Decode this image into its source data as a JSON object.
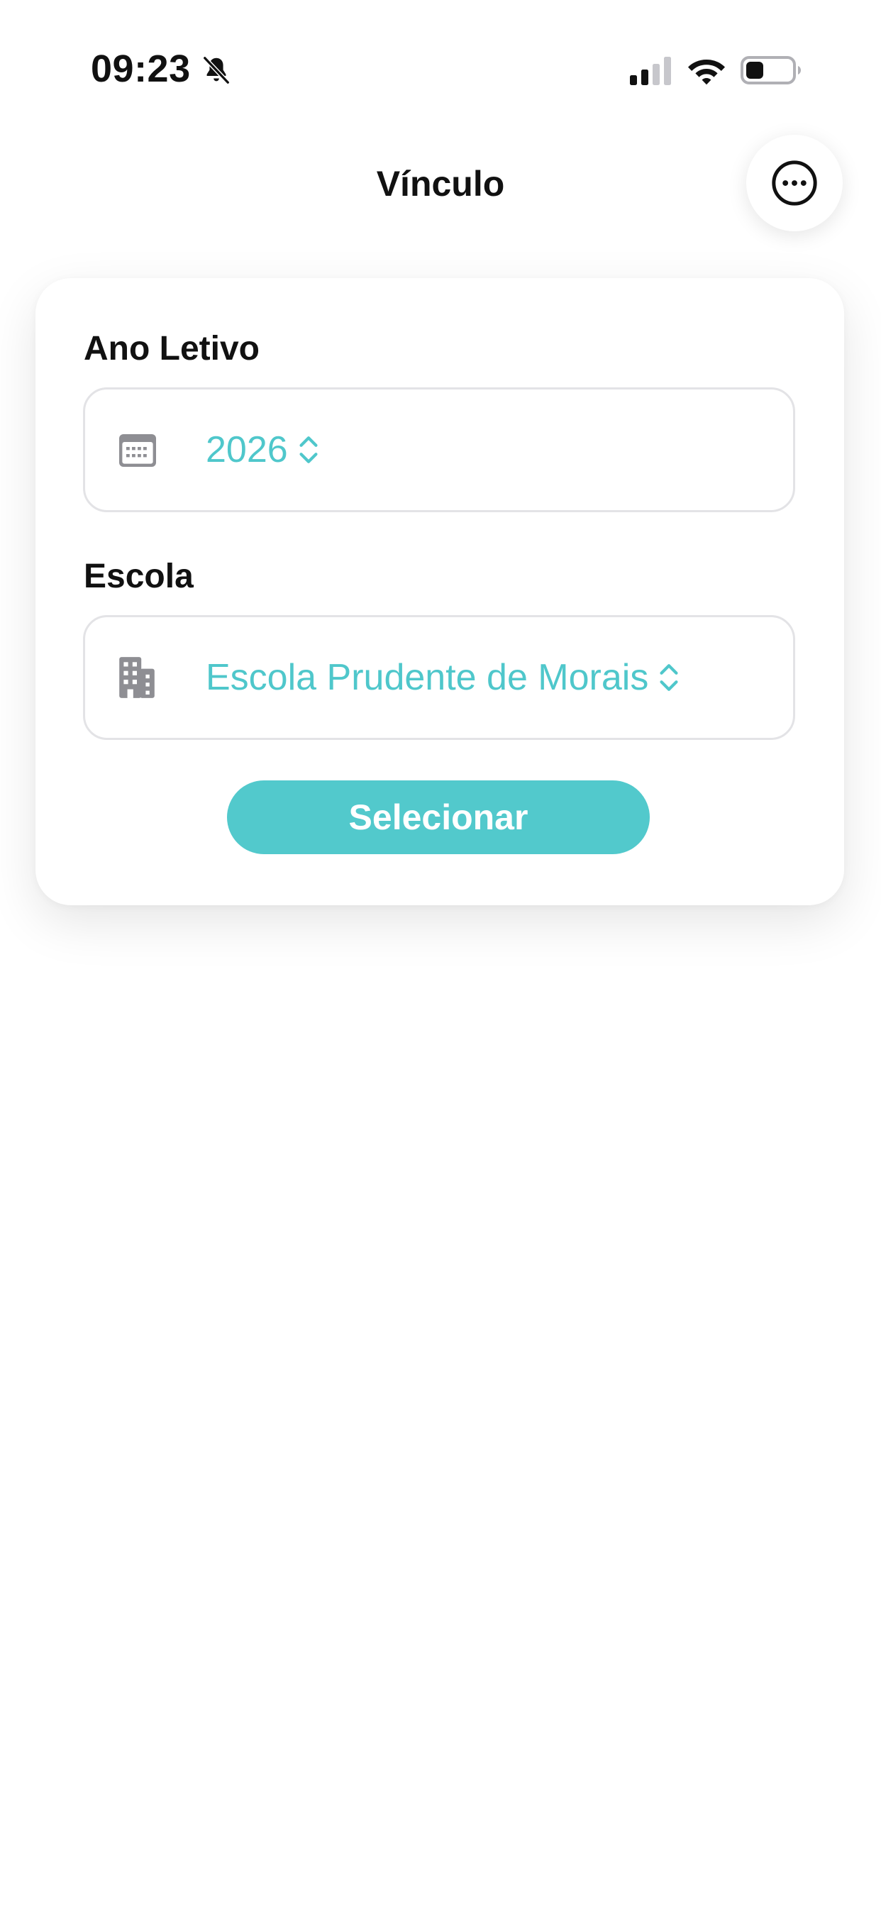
{
  "status_bar": {
    "time": "09:23",
    "icons": [
      "bell-off-icon",
      "signal-icon",
      "wifi-icon",
      "battery-icon"
    ]
  },
  "header": {
    "title": "Vínculo",
    "more_icon": "ellipsis-circle-icon"
  },
  "form": {
    "year_label": "Ano Letivo",
    "year_value": "2026",
    "year_icon": "calendar-icon",
    "school_label": "Escola",
    "school_value": "Escola Prudente de Morais",
    "school_icon": "building-icon",
    "submit_label": "Selecionar"
  },
  "colors": {
    "accent": "#52c9cc",
    "value_text": "#4fc7cb",
    "text": "#111111",
    "border": "#e3e3e6",
    "icon_gray": "#8e8e93"
  }
}
